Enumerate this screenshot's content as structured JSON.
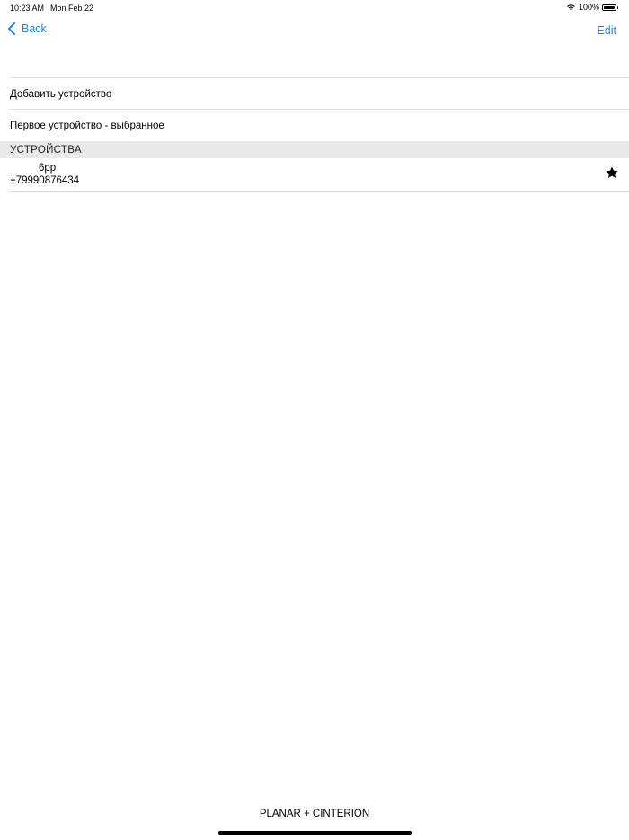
{
  "status_bar": {
    "time": "10:23 AM",
    "date": "Mon Feb 22",
    "battery_percent": "100%",
    "battery_level": 1.0,
    "icons": [
      "wifi-icon",
      "battery-icon"
    ]
  },
  "nav": {
    "back_label": "Back",
    "edit_label": "Edit",
    "accent_color": "#1d83ec"
  },
  "menu": {
    "add_device": "Добавить устройство",
    "first_favorite": "Первое устройство - выбранное"
  },
  "devices_section": {
    "header": "УСТРОЙСТВА",
    "items": [
      {
        "name": "6pp",
        "phone": "+79990876434",
        "favorite_icon": "star-icon"
      }
    ]
  },
  "footer": {
    "text": "PLANAR + CINTERION"
  }
}
